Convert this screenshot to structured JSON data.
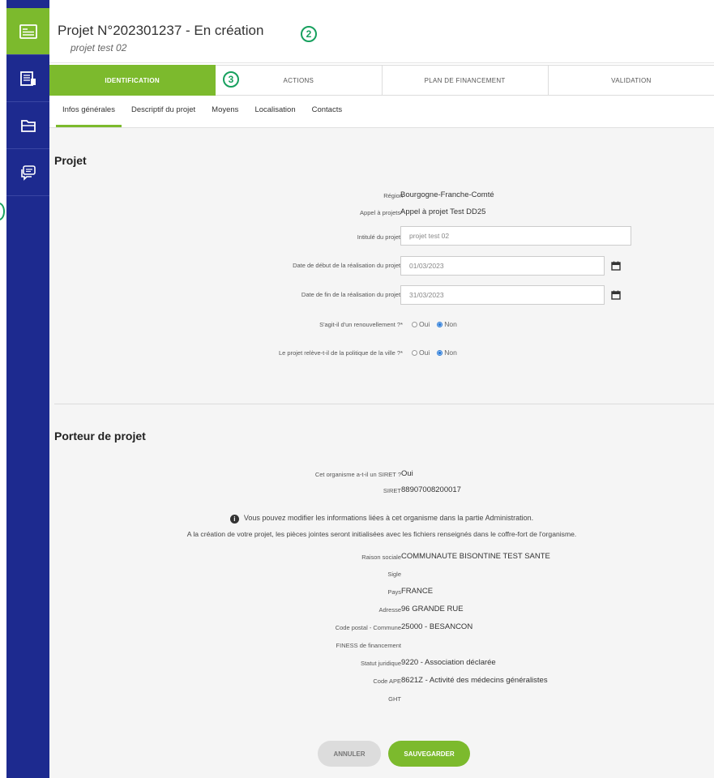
{
  "header": {
    "title": "Projet N°202301237 - En création",
    "subtitle": "projet test 02",
    "marker_2": "2",
    "marker_3": "3"
  },
  "steps": [
    {
      "label": "IDENTIFICATION"
    },
    {
      "label": "ACTIONS"
    },
    {
      "label": "PLAN DE FINANCEMENT"
    },
    {
      "label": "VALIDATION"
    }
  ],
  "subtabs": [
    {
      "label": "Infos générales"
    },
    {
      "label": "Descriptif du projet"
    },
    {
      "label": "Moyens"
    },
    {
      "label": "Localisation"
    },
    {
      "label": "Contacts"
    }
  ],
  "projet": {
    "title": "Projet",
    "region_label": "Région",
    "region_value": "Bourgogne-Franche-Comté",
    "appel_label": "Appel à projets*",
    "appel_value": "Appel à projet Test DD25",
    "intitule_label": "Intitulé du projet*",
    "intitule_value": "projet test 02",
    "date_debut_label": "Date de début de la réalisation du projet*",
    "date_debut_value": "01/03/2023",
    "date_fin_label": "Date de fin de la réalisation du projet*",
    "date_fin_value": "31/03/2023",
    "renouvellement_label": "S'agit-il d'un renouvellement ?*",
    "politique_label": "Le projet relève-t-il de la politique de la ville ?*",
    "option_oui": "Oui",
    "option_non": "Non"
  },
  "porteur": {
    "title": "Porteur de projet",
    "siret_question_label": "Cet organisme a-t-il un SIRET ?",
    "siret_question_value": "Oui",
    "siret_label": "SIRET",
    "siret_value": "88907008200017",
    "info_line_1": "Vous pouvez modifier les informations liées à cet organisme dans la partie Administration.",
    "info_line_2": "A la création de votre projet, les pièces jointes seront initialisées avec les fichiers renseignés dans le coffre-fort de l'organisme.",
    "raison_label": "Raison sociale",
    "raison_value": "COMMUNAUTE BISONTINE TEST SANTE",
    "sigle_label": "Sigle",
    "pays_label": "Pays",
    "pays_value": "FRANCE",
    "adresse_label": "Adresse",
    "adresse_value": "96 GRANDE RUE",
    "cp_label": "Code postal - Commune",
    "cp_value": "25000 - BESANCON",
    "finess_label": "FINESS de financement",
    "statut_label": "Statut juridique",
    "statut_value": "9220 - Association déclarée",
    "ape_label": "Code APE",
    "ape_value": "8621Z - Activité des médecins généralistes",
    "ght_label": "GHT"
  },
  "actions": {
    "cancel_label": "ANNULER",
    "save_label": "SAUVEGARDER"
  },
  "colors": {
    "rail": "#1d2a8f",
    "accent_green": "#7cba2d",
    "marker_green": "#17a05e",
    "radio_blue": "#2a7bd8"
  },
  "icons": {
    "rail": [
      "project-list-icon",
      "dashboard-icon",
      "folder-icon",
      "chat-icon"
    ],
    "info": "info-icon",
    "calendar": "calendar-icon"
  }
}
